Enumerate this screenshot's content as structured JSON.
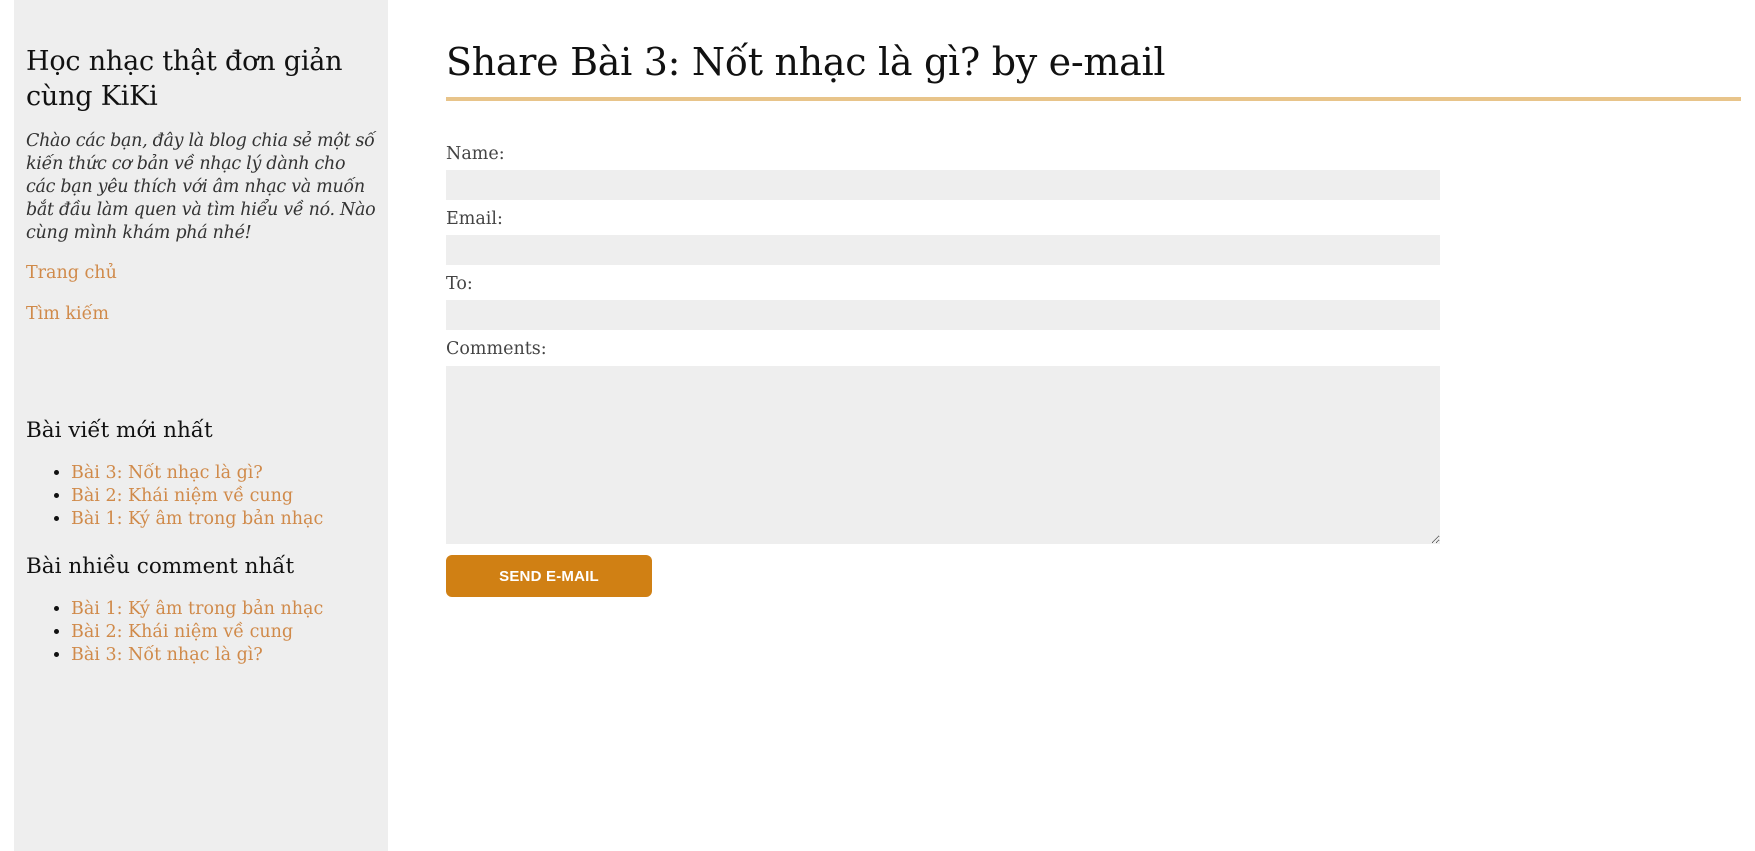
{
  "sidebar": {
    "site_title": "Học nhạc thật đơn giản cùng KiKi",
    "description": "Chào các bạn, đây là blog chia sẻ một số kiến thức cơ bản về nhạc lý dành cho các bạn yêu thích với âm nhạc và muốn bắt đầu làm quen và tìm hiểu về nó. Nào cùng mình khám phá nhé!",
    "nav": [
      {
        "label": "Trang chủ"
      },
      {
        "label": "Tìm kiếm"
      }
    ],
    "recent_heading": "Bài viết mới nhất",
    "recent_posts": [
      {
        "label": "Bài 3: Nốt nhạc là gì?"
      },
      {
        "label": "Bài 2: Khái niệm về cung"
      },
      {
        "label": "Bài 1: Ký âm trong bản nhạc"
      }
    ],
    "popular_heading": "Bài nhiều comment nhất",
    "popular_posts": [
      {
        "label": "Bài 1: Ký âm trong bản nhạc"
      },
      {
        "label": "Bài 2: Khái niệm về cung"
      },
      {
        "label": "Bài 3: Nốt nhạc là gì?"
      }
    ]
  },
  "main": {
    "title": "Share Bài 3: Nốt nhạc là gì? by e-mail",
    "form": {
      "name_label": "Name:",
      "name_value": "",
      "email_label": "Email:",
      "email_value": "",
      "to_label": "To:",
      "to_value": "",
      "comments_label": "Comments:",
      "comments_value": "",
      "submit_label": "SEND E-MAIL"
    }
  },
  "colors": {
    "link": "#d08a4a",
    "accent_rule": "#e8c48a",
    "button": "#d08014",
    "sidebar_bg": "#eeeeee"
  }
}
